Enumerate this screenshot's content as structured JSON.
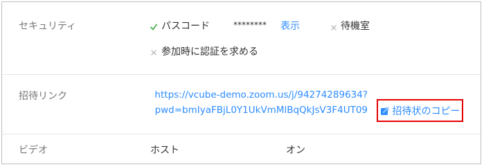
{
  "security": {
    "label": "セキュリティ",
    "passcode_label": "パスコード",
    "passcode_value": "********",
    "show_link": "表示",
    "waiting_room_label": "待機室",
    "auth_label": "参加時に認証を求める"
  },
  "invite": {
    "label": "招待リンク",
    "url_line1": "https://vcube-demo.zoom.us/j/94274289634?",
    "url_line2": "pwd=bmIyaFBjL0Y1UkVmMlBqQkJsV3F4UT09",
    "copy_label": "招待状のコピー"
  },
  "video": {
    "label": "ビデオ",
    "host_label": "ホスト",
    "host_value": "オン"
  },
  "colors": {
    "accent": "#2d8cff",
    "check": "#4caf50",
    "highlight_border": "#e60000"
  }
}
